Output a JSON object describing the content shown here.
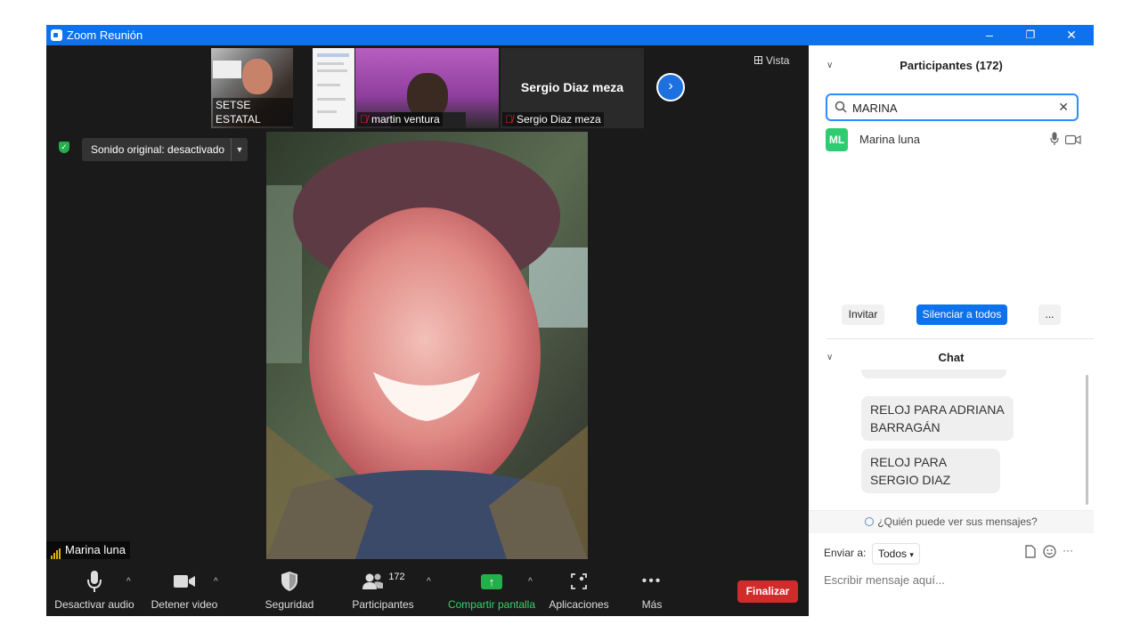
{
  "window": {
    "title": "Zoom Reunión",
    "minimize": "–",
    "restore": "❐",
    "close": "✕"
  },
  "stage": {
    "thumbnails": [
      {
        "name": "SETSE ESTATAL",
        "muted": false
      },
      {
        "name": "martin ventura",
        "muted": true
      },
      {
        "name": "Sergio Diaz meza",
        "muted": true,
        "big_name": "Sergio Diaz meza"
      }
    ],
    "next_icon": "›",
    "view_label": "Vista",
    "sound_label": "Sonido original: desactivado",
    "speaker_name": "Marina luna"
  },
  "toolbar": {
    "audio": "Desactivar audio",
    "video": "Detener video",
    "security": "Seguridad",
    "participants": "Participantes",
    "participants_count": "172",
    "share": "Compartir pantalla",
    "apps": "Aplicaciones",
    "more": "Más",
    "end": "Finalizar"
  },
  "panel": {
    "participants_title": "Participantes (172)",
    "search_value": "MARINA",
    "participant": {
      "initials": "ML",
      "name": "Marina luna"
    },
    "invite": "Invitar",
    "mute_all": "Silenciar a todos",
    "more": "...",
    "chat_title": "Chat",
    "messages": [
      "RELOJ PARA ADRIANA BARRAGÁN",
      "RELOJ PARA SERGIO DIAZ"
    ],
    "who_sees": "¿Quién puede ver sus mensajes?",
    "send_to_label": "Enviar a:",
    "send_to_value": "Todos",
    "message_placeholder": "Escribir mensaje aquí..."
  },
  "colors": {
    "accent": "#0e72ed",
    "end": "#d22b2b",
    "share": "#23b04a",
    "avatar": "#2ecc71"
  }
}
